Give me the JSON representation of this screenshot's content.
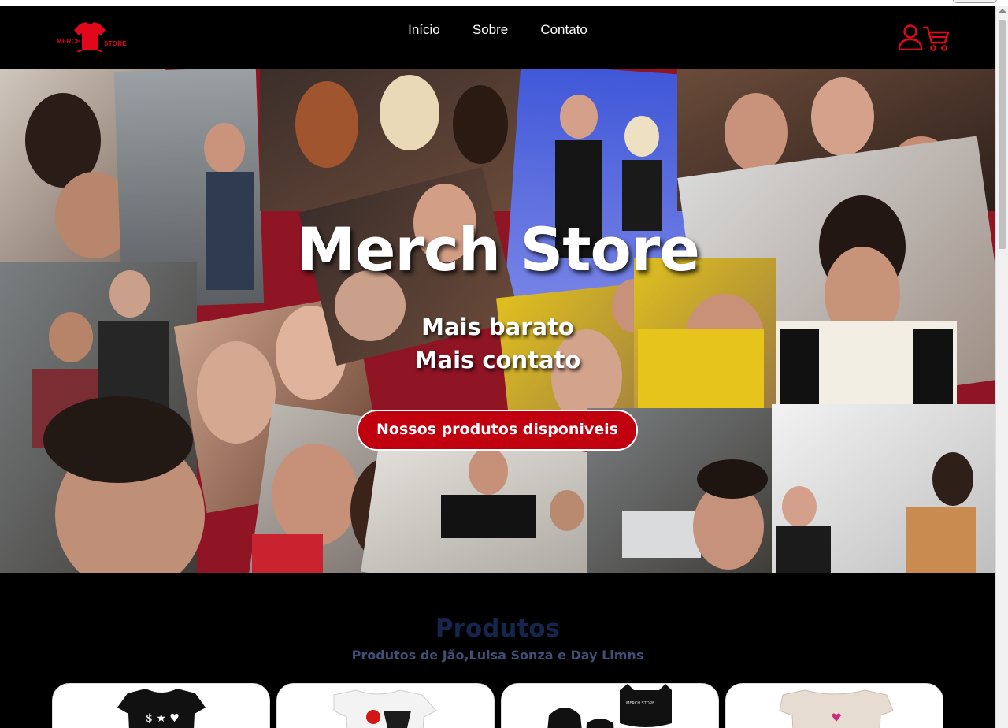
{
  "brand": {
    "logo_word_left": "MERCH",
    "logo_word_right": "STORE",
    "accent_color": "#e1081b"
  },
  "nav": {
    "items": [
      {
        "label": "Início"
      },
      {
        "label": "Sobre"
      },
      {
        "label": "Contato"
      }
    ],
    "icons": [
      "user-icon",
      "cart-icon"
    ]
  },
  "hero": {
    "title": "Merch Store",
    "line1": "Mais barato",
    "line2": "Mais contato",
    "cta_label": "Nossos produtos disponiveis",
    "cta_color": "#c1000f"
  },
  "products": {
    "title": "Produtos",
    "subtitle": "Produtos de Jão,Luisa Sonza e Day Limns",
    "cards": [
      {
        "image": "black-tshirt"
      },
      {
        "image": "white-tshirt"
      },
      {
        "image": "black-beanies"
      },
      {
        "image": "beige-tshirt"
      }
    ]
  }
}
